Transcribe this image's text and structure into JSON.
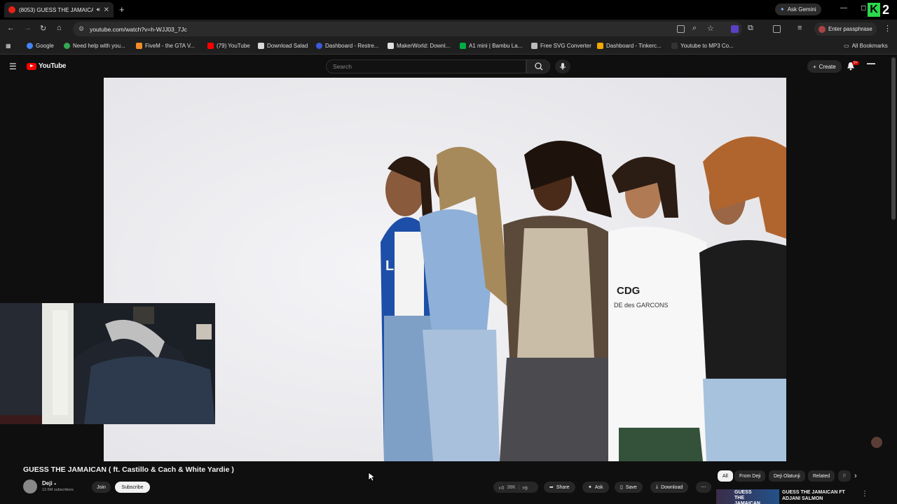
{
  "browser": {
    "tab_title": "(8053) GUESS THE JAMAICA",
    "url": "youtube.com/watch?v=h-WJJ03_7Jc",
    "ask_gemini": "Ask Gemini",
    "enter_passphrase": "Enter passphrase",
    "overlay_badge_number": "2"
  },
  "bookmarks": {
    "items": [
      {
        "label": "Google",
        "color": "#4285f4"
      },
      {
        "label": "Need help with you...",
        "color": "#34a853"
      },
      {
        "label": "FiveM - the GTA V...",
        "color": "#f28c28"
      },
      {
        "label": "(79) YouTube",
        "color": "#ff0000"
      },
      {
        "label": "Download Salad",
        "color": "#d9d9d9"
      },
      {
        "label": "Dashboard - Restre...",
        "color": "#3b5bdb"
      },
      {
        "label": "MakerWorld: Downl...",
        "color": "#e0e0e0"
      },
      {
        "label": "A1 mini | Bambu La...",
        "color": "#00ae42"
      },
      {
        "label": "Free SVG Converter",
        "color": "#bbbbbb"
      },
      {
        "label": "Dashboard - Tinkerc...",
        "color": "#f2a900"
      },
      {
        "label": "Youtube to MP3 Co...",
        "color": "#333333"
      }
    ],
    "all_bookmarks": "All Bookmarks"
  },
  "youtube": {
    "logo_text": "YouTube",
    "search_placeholder": "Search",
    "create_label": "Create",
    "notifications": "9+",
    "video_title": "GUESS THE JAMAICAN ( ft. Castillo & Cach & White Yardie )",
    "channel_name": "Deji",
    "subscribers": "12.6M subscribers",
    "join_label": "Join",
    "subscribe_label": "Subscribe",
    "likes": "38K",
    "share_label": "Share",
    "ask_label": "Ask",
    "save_label": "Save",
    "download_label": "Download",
    "chips": [
      "All",
      "From Deji",
      "Deji Olatunji",
      "Related",
      "F"
    ],
    "rec_thumb_text": "GUESS THE JAMAICAN",
    "rec_title_line1": "GUESS THE JAMAICAN FT",
    "rec_title_line2": "ADJANI SALMON",
    "overlay_text_left": "CDG",
    "overlay_text_right": "DE des GARCONS",
    "jacket_text": "LIA"
  },
  "colors": {
    "youtube_red": "#ff0000",
    "background": "#0f0f0f",
    "video_bg": "#ebebee",
    "k_badge": "#2bd94c"
  }
}
